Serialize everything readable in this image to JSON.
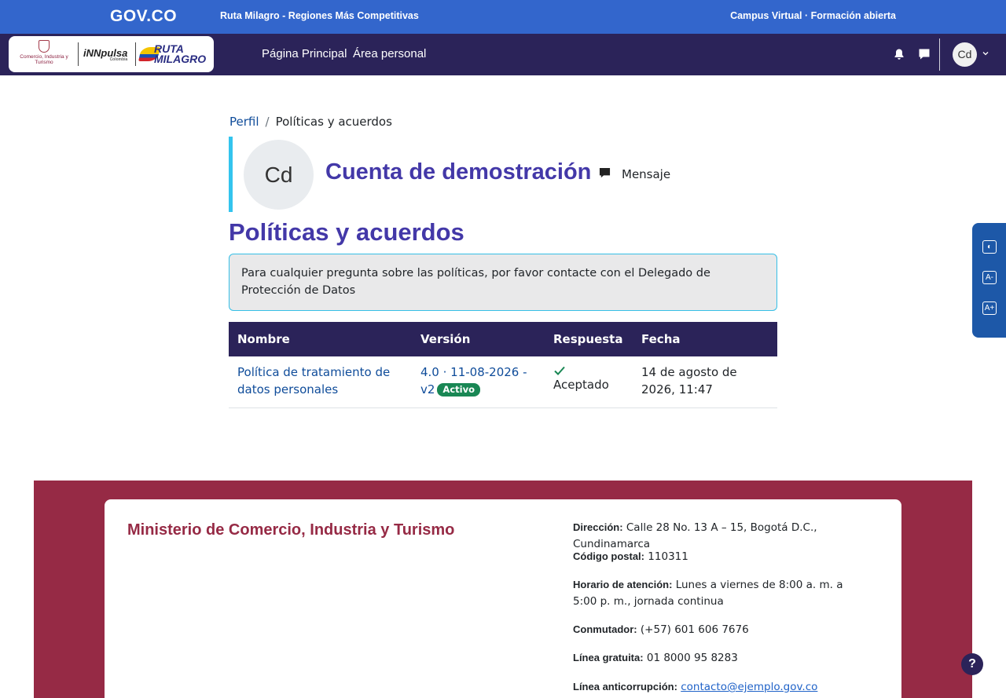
{
  "govbar": {
    "logo": "GOV.CO",
    "title": "Ruta Milagro - Regiones Más Competitivas",
    "right_text": "Campus Virtual · Formación abierta"
  },
  "brand": {
    "mincit": "Comercio, Industria y Turismo",
    "innpulsa": "iNNpulsa",
    "innpulsa_sub": "Colombia",
    "ruta_line1": "RUTA",
    "ruta_line2": "MILAGRO"
  },
  "nav": {
    "home": "Página Principal",
    "personal": "Área personal",
    "avatar_initials": "Cd",
    "icons": [
      "bell-icon",
      "chat-icon",
      "chevron-down-icon"
    ]
  },
  "breadcrumb": {
    "profile": "Perfil",
    "separator": "/",
    "current": "Políticas y acuerdos"
  },
  "profile": {
    "initials": "Cd",
    "name": "Cuenta de demostración",
    "message_label": "Mensaje"
  },
  "page": {
    "title": "Políticas y acuerdos",
    "notice": "Para cualquier pregunta sobre las políticas, por favor contacte con el Delegado de Protección de Datos"
  },
  "table": {
    "headers": [
      "Nombre",
      "Versión",
      "Respuesta",
      "Fecha"
    ],
    "rows": [
      {
        "name": "Política de tratamiento de datos personales",
        "version": "4.0 · 11-08-2026 - v2",
        "badge": "Activo",
        "response": "Aceptado",
        "date": "14 de agosto de 2026, 11:47"
      }
    ]
  },
  "a11y": {
    "contrast": "◐",
    "decrease": "A-",
    "increase": "A+"
  },
  "footer": {
    "title": "Ministerio de Comercio, Industria y Turismo",
    "address_label": "Dirección:",
    "address": "Calle 28 No. 13 A – 15, Bogotá D.C., Cundinamarca",
    "postal_label": "Código postal:",
    "postal": "110311",
    "hours_label": "Horario de atención:",
    "hours": "Lunes a viernes de 8:00 a. m. a 5:00 p. m., jornada continua",
    "switch_label": "Conmutador:",
    "switch": "(+57) 601 606 7676",
    "free_label": "Línea gratuita:",
    "free": "01 8000 95 8283",
    "anticorr_label": "Línea anticorrupción:",
    "anticorr": "contacto@ejemplo.gov.co"
  },
  "help": "?",
  "colors": {
    "gov_blue": "#3366cc",
    "navy": "#2b2359",
    "title_purple": "#4338a8",
    "link_blue": "#0f4c9a",
    "footer_red": "#962a45",
    "badge_green": "#198754",
    "accent_cyan": "#33c4ee"
  }
}
